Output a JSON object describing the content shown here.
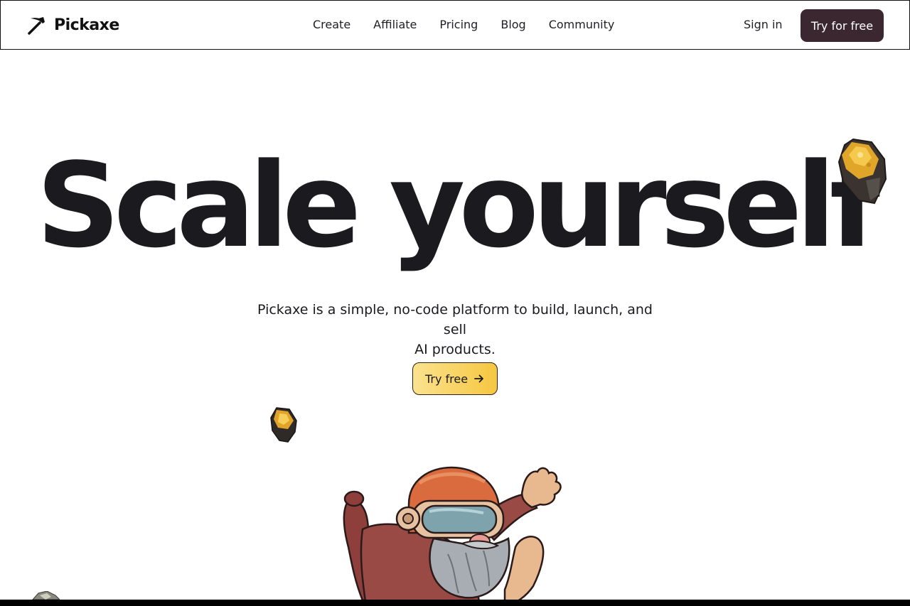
{
  "header": {
    "brand": "Pickaxe",
    "logo_icon": "pickaxe-icon",
    "nav": [
      {
        "label": "Create"
      },
      {
        "label": "Affiliate"
      },
      {
        "label": "Pricing"
      },
      {
        "label": "Blog"
      },
      {
        "label": "Community"
      }
    ],
    "sign_in": "Sign in",
    "cta": "Try for free",
    "cta_color": "#3b2730"
  },
  "hero": {
    "title": "Scale yourself",
    "subtitle_line1": "Pickaxe is a simple, no-code platform to build, launch, and sell",
    "subtitle_line2": "AI products.",
    "cta": "Try free",
    "cta_icon": "arrow-right-icon",
    "cta_gradient": [
      "#fbe28e",
      "#f6c740"
    ]
  },
  "decor": {
    "rock_icon": "gold-ore-rock",
    "character": "miner-astronaut-illustration"
  }
}
